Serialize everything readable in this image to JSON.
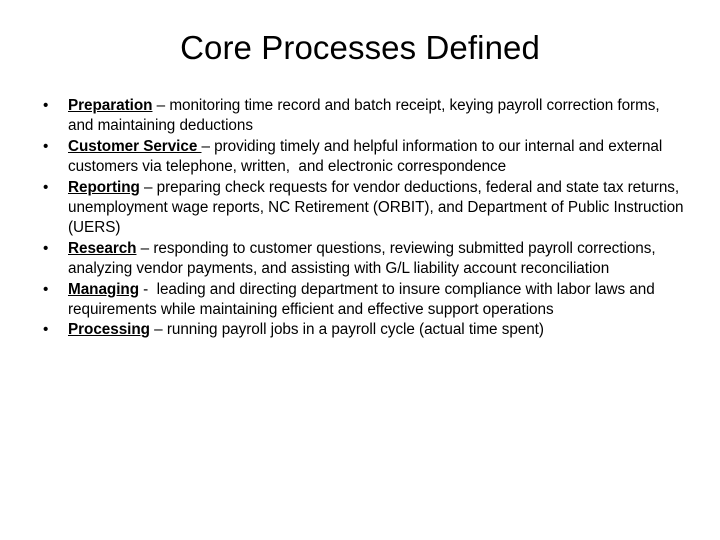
{
  "slide": {
    "title": "Core Processes Defined",
    "background_color": "#ffffff",
    "text_color": "#000000",
    "bullet_glyph": "•"
  },
  "bullets": [
    {
      "term": "Preparation",
      "description": " – monitoring time record and batch receipt, keying payroll correction forms, and maintaining deductions"
    },
    {
      "term": "Customer Service ",
      "description": "– providing timely and helpful information to our internal and external customers via telephone, written,  and electronic correspondence"
    },
    {
      "term": "Reporting",
      "description": " – preparing check requests for vendor deductions, federal and state tax returns, unemployment wage reports, NC Retirement (ORBIT), and Department of Public Instruction (UERS)"
    },
    {
      "term": "Research",
      "description": " – responding to customer questions, reviewing submitted payroll corrections, analyzing vendor payments, and assisting with G/L liability account reconciliation"
    },
    {
      "term": "Managing",
      "description": " -  leading and directing department to insure compliance with labor laws and requirements while maintaining efficient and effective support operations"
    },
    {
      "term": "Processing",
      "description": " – running payroll jobs in a payroll cycle (actual time spent)"
    }
  ]
}
